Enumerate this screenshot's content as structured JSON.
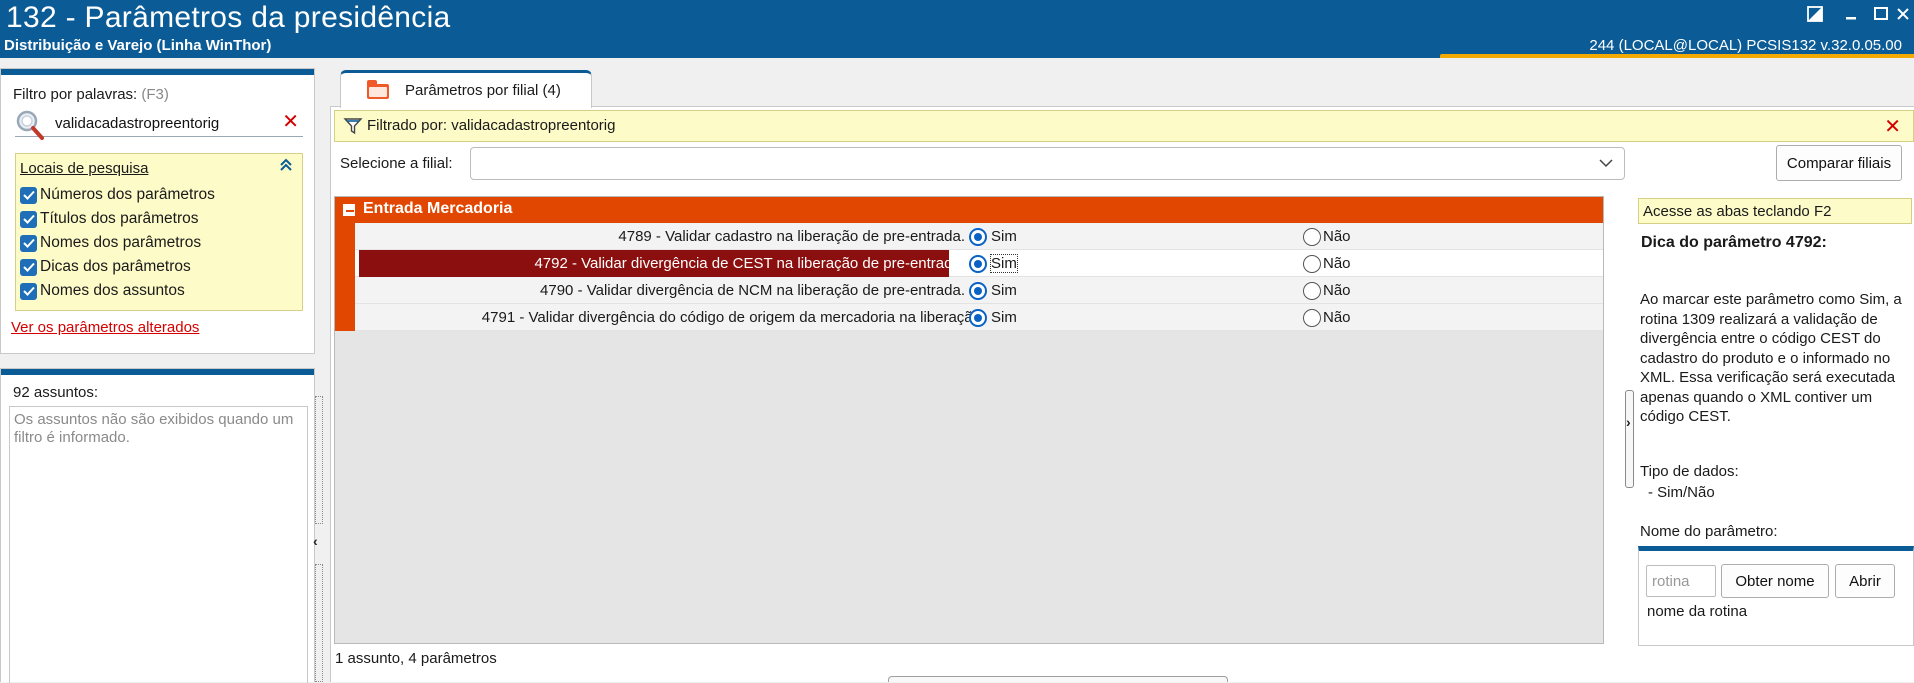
{
  "window": {
    "title": "132 - Parâmetros da presidência",
    "subtitle": "Distribuição e Varejo (Linha WinThor)",
    "system_info": "244 (LOCAL@LOCAL)   PCSIS132  v.32.0.05.00",
    "accent_color": "#f2a900",
    "brand_color": "#0b5c96"
  },
  "filter": {
    "label": "Filtro por palavras:",
    "shortcut_hint": "(F3)",
    "value": "validacadastropreentorig",
    "locais_title": "Locais de pesquisa",
    "options": [
      {
        "label": "Números dos parâmetros",
        "checked": true
      },
      {
        "label": "Títulos dos parâmetros",
        "checked": true
      },
      {
        "label": "Nomes dos parâmetros",
        "checked": true
      },
      {
        "label": "Dicas dos parâmetros",
        "checked": true
      },
      {
        "label": "Nomes dos assuntos",
        "checked": true
      }
    ],
    "altered_link": "Ver os parâmetros alterados"
  },
  "subjects": {
    "count_label": "92 assuntos:",
    "empty_message": "Os assuntos não são exibidos quando um filtro é informado."
  },
  "tab": {
    "label": "Parâmetros por filial  (4)"
  },
  "filter_bar": {
    "text": "Filtrado por: validacadastropreentorig"
  },
  "filial": {
    "label": "Selecione a filial:",
    "compare_button": "Comparar filiais"
  },
  "grid": {
    "group_title": "Entrada Mercadoria",
    "rows": [
      {
        "name": "4789 - Validar cadastro na liberação de pre-entrada.",
        "value": "Sim",
        "selected": false
      },
      {
        "name": "4792 - Validar divergência de CEST na liberação de pre-entrada.",
        "value": "Sim",
        "selected": true
      },
      {
        "name": "4790 - Validar divergência de NCM na liberação de pre-entrada.",
        "value": "Sim",
        "selected": false
      },
      {
        "name": "4791 - Validar divergência do código de origem da mercadoria na liberação",
        "value": "Sim",
        "selected": false
      }
    ],
    "option_yes": "Sim",
    "option_no": "Não"
  },
  "status": {
    "text": "1 assunto, 4 parâmetros"
  },
  "hint": {
    "shortcut_bar": "Acesse as abas teclando F2",
    "title": "Dica do parâmetro 4792:",
    "text": "Ao marcar este parâmetro como Sim, a rotina 1309 realizará a validação de divergência entre o código CEST do cadastro do produto e o informado no XML. Essa verificação será executada apenas quando o XML contiver um código CEST.",
    "data_type_label": "Tipo de dados:",
    "data_type_value": "- Sim/Não",
    "name_label": "Nome do parâmetro:",
    "rotina_placeholder": "rotina",
    "obter_button": "Obter nome",
    "abrir_button": "Abrir",
    "name_value": "nome da rotina"
  }
}
